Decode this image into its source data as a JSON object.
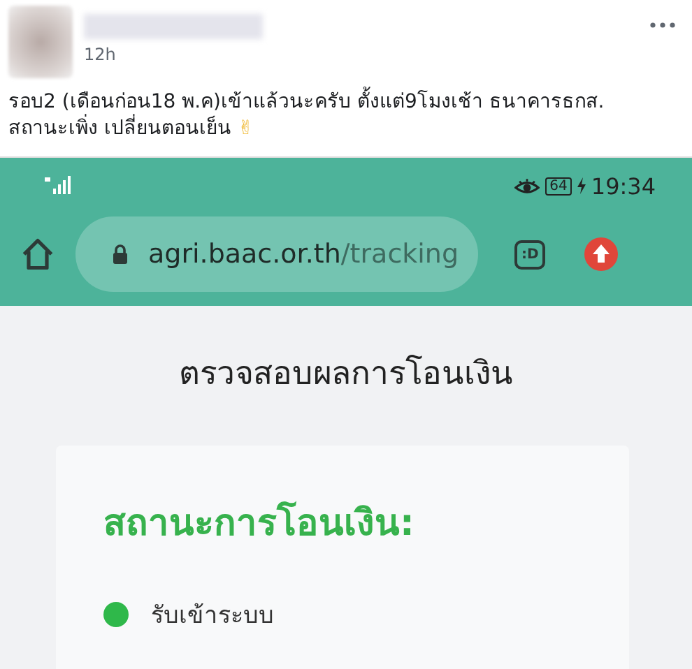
{
  "post": {
    "time": "12h",
    "text": "รอบ2 (เดือนก่อน18 พ.ค)เข้าแล้วนะครับ ตั้งแต่9โมงเช้า ธนาคารธกส. สถานะเพิ่ง เปลี่ยนตอนเย็น",
    "emoji": "✌"
  },
  "phone": {
    "status_bar": {
      "battery": "64",
      "time": "19:34"
    },
    "browser": {
      "url_host": "agri.baac.or.th",
      "url_path": "/tracking",
      "tab_count": ":D"
    },
    "page": {
      "title": "ตรวจสอบผลการโอนเงิน",
      "status_heading": "สถานะการโอนเงิน:",
      "steps": [
        {
          "label": "รับเข้าระบบ",
          "done": true
        }
      ]
    }
  }
}
